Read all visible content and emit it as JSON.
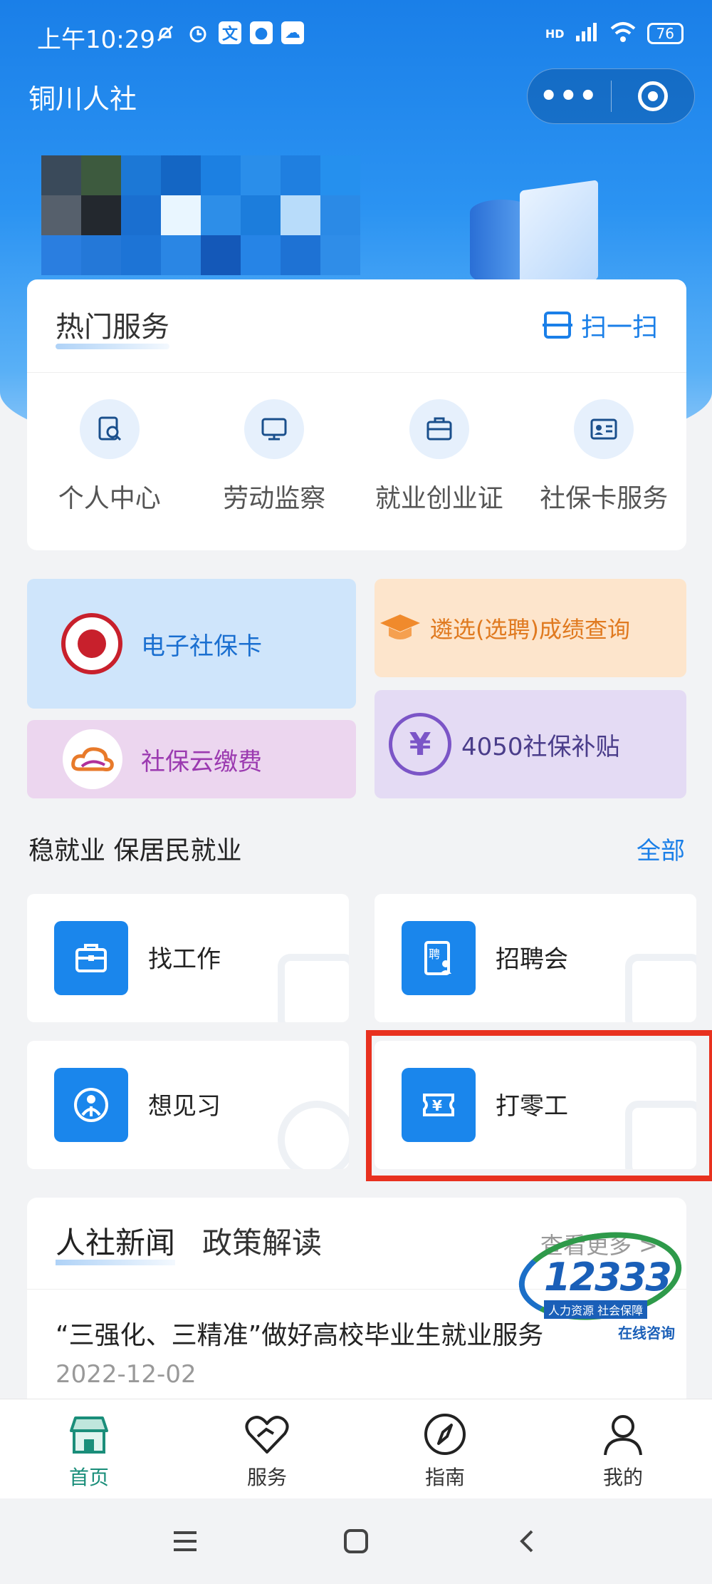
{
  "status_bar": {
    "time": "上午10:29",
    "battery": "76",
    "network": "HD",
    "app_badge_text": "文"
  },
  "miniprogram": {
    "title": "铜川人社",
    "more_label": "•••"
  },
  "hot_services": {
    "title": "热门服务",
    "scan_label": "扫一扫",
    "items": [
      {
        "label": "个人中心",
        "icon": "profile-search-icon"
      },
      {
        "label": "劳动监察",
        "icon": "monitor-icon"
      },
      {
        "label": "就业创业证",
        "icon": "briefcase-icon"
      },
      {
        "label": "社保卡服务",
        "icon": "id-card-icon"
      }
    ]
  },
  "tiles": {
    "ecard": "电子社保卡",
    "exam": "遴选(选聘)成绩查询",
    "cloud_pay": "社保云缴费",
    "subsidy": "4050社保补贴"
  },
  "employment": {
    "title": "稳就业 保居民就业",
    "all_label": "全部",
    "items": [
      {
        "label": "找工作",
        "icon": "toolbox-icon"
      },
      {
        "label": "招聘会",
        "icon": "recruit-icon"
      },
      {
        "label": "想见习",
        "icon": "person-icon"
      },
      {
        "label": "打零工",
        "icon": "yen-ticket-icon"
      }
    ]
  },
  "news": {
    "tabs": [
      "人社新闻",
      "政策解读"
    ],
    "more_label": "查看更多 >",
    "headline": "“三强化、三精准”做好高校毕业生就业服务",
    "date": "2022-12-02"
  },
  "hotline": {
    "number": "12333",
    "strip": "人力资源 社会保障",
    "sub": "在线咨询"
  },
  "tabbar": {
    "items": [
      {
        "label": "首页",
        "icon": "home-icon",
        "active": true
      },
      {
        "label": "服务",
        "icon": "heart-icon",
        "active": false
      },
      {
        "label": "指南",
        "icon": "compass-icon",
        "active": false
      },
      {
        "label": "我的",
        "icon": "user-icon",
        "active": false
      }
    ]
  },
  "colors": {
    "brand": "#1a7fe8",
    "active_tab": "#1a8e7a",
    "highlight": "#e8311f"
  }
}
